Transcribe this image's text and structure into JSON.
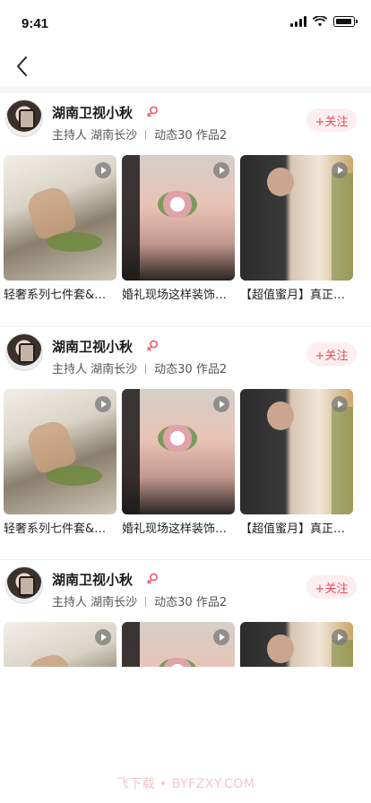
{
  "status_bar": {
    "time": "9:41",
    "icons": [
      "signal-icon",
      "wifi-icon",
      "battery-icon"
    ]
  },
  "nav": {
    "back_icon": "chevron-left-icon"
  },
  "follow_color": "#e9485a",
  "sections": [
    {
      "user": {
        "name": "湖南卫视小秋",
        "gender_icon": "female-icon",
        "role_location": "主持人 湖南长沙",
        "stats": "动态30 作品2",
        "follow_label": "+关注"
      },
      "works": [
        {
          "caption": "轻奢系列七件套&amp;可…",
          "is_video": true
        },
        {
          "caption": "婚礼现场这样装饰…",
          "is_video": true
        },
        {
          "caption": "【超值蜜月】真正…",
          "is_video": true
        }
      ]
    },
    {
      "user": {
        "name": "湖南卫视小秋",
        "gender_icon": "female-icon",
        "role_location": "主持人 湖南长沙",
        "stats": "动态30 作品2",
        "follow_label": "+关注"
      },
      "works": [
        {
          "caption": "轻奢系列七件套&amp;可…",
          "is_video": true
        },
        {
          "caption": "婚礼现场这样装饰…",
          "is_video": true
        },
        {
          "caption": "【超值蜜月】真正…",
          "is_video": true
        }
      ]
    },
    {
      "user": {
        "name": "湖南卫视小秋",
        "gender_icon": "female-icon",
        "role_location": "主持人 湖南长沙",
        "stats": "动态30 作品2",
        "follow_label": "+关注"
      },
      "works": [
        {
          "caption": "",
          "is_video": true
        },
        {
          "caption": "",
          "is_video": true
        },
        {
          "caption": "",
          "is_video": true
        }
      ]
    }
  ],
  "watermark": "飞下载 • BYFZXY.COM"
}
